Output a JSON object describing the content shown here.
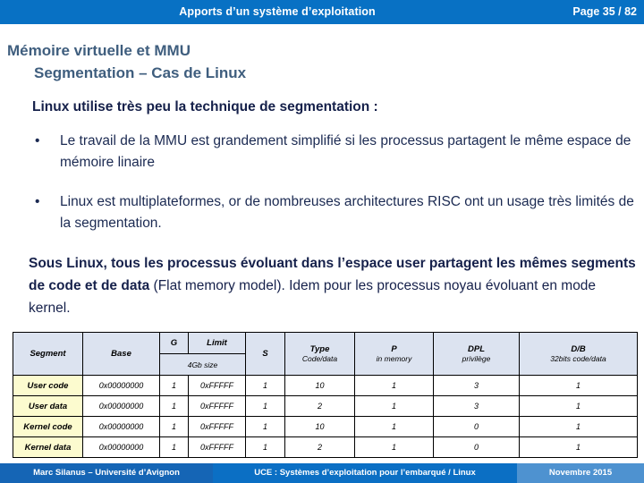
{
  "header": {
    "title": "Apports  d’un système d’exploitation",
    "page_label": "Page 35 / 82",
    "bg_color": "#0871C4"
  },
  "slide": {
    "title_line1": "Mémoire virtuelle et MMU",
    "title_line2": "Segmentation – Cas de Linux",
    "title_color": "#3F5E7E",
    "lead": "Linux utilise très peu la technique de segmentation :",
    "bullets": [
      {
        "marker": "•",
        "text": "Le travail de la MMU est grandement simplifié si les processus partagent le même espace de mémoire linaire"
      },
      {
        "marker": "•",
        "text": "Linux est multiplateformes, or de nombreuses architectures RISC ont un usage très limités de la segmentation."
      }
    ],
    "paragraph_bold": "Sous Linux, tous les processus évoluant dans l’espace user partagent les mêmes segments de code et de data",
    "paragraph_rest": " (Flat memory model). Idem pour les processus noyau évoluant en mode kernel."
  },
  "table": {
    "header_bg": "#DCE3F0",
    "name_cell_bg": "#FCFBCF",
    "columns": [
      {
        "label": "Segment",
        "sub": ""
      },
      {
        "label": "Base",
        "sub": ""
      },
      {
        "label": "G",
        "sub": ""
      },
      {
        "label": "Limit",
        "sub": ""
      },
      {
        "label": "S",
        "sub": ""
      },
      {
        "label": "Type",
        "sub": "Code/data"
      },
      {
        "label": "P",
        "sub": "in memory"
      },
      {
        "label": "DPL",
        "sub": "privilège"
      },
      {
        "label": "D/B",
        "sub": "32bits code/data"
      }
    ],
    "span_label": "4Gb size",
    "rows": [
      {
        "segment": "User code",
        "base": "0x00000000",
        "g": "1",
        "limit": "0xFFFFF",
        "s": "1",
        "type": "10",
        "p": "1",
        "dpl": "3",
        "db": "1"
      },
      {
        "segment": "User data",
        "base": "0x00000000",
        "g": "1",
        "limit": "0xFFFFF",
        "s": "1",
        "type": "2",
        "p": "1",
        "dpl": "3",
        "db": "1"
      },
      {
        "segment": "Kernel code",
        "base": "0x00000000",
        "g": "1",
        "limit": "0xFFFFF",
        "s": "1",
        "type": "10",
        "p": "1",
        "dpl": "0",
        "db": "1"
      },
      {
        "segment": "Kernel data",
        "base": "0x00000000",
        "g": "1",
        "limit": "0xFFFFF",
        "s": "1",
        "type": "2",
        "p": "1",
        "dpl": "0",
        "db": "1"
      }
    ]
  },
  "footer": {
    "author": "Marc Silanus – Université d’Avignon",
    "course": "UCE : Systèmes d’exploitation pour l’embarqué / Linux",
    "date": "Novembre 2015"
  }
}
